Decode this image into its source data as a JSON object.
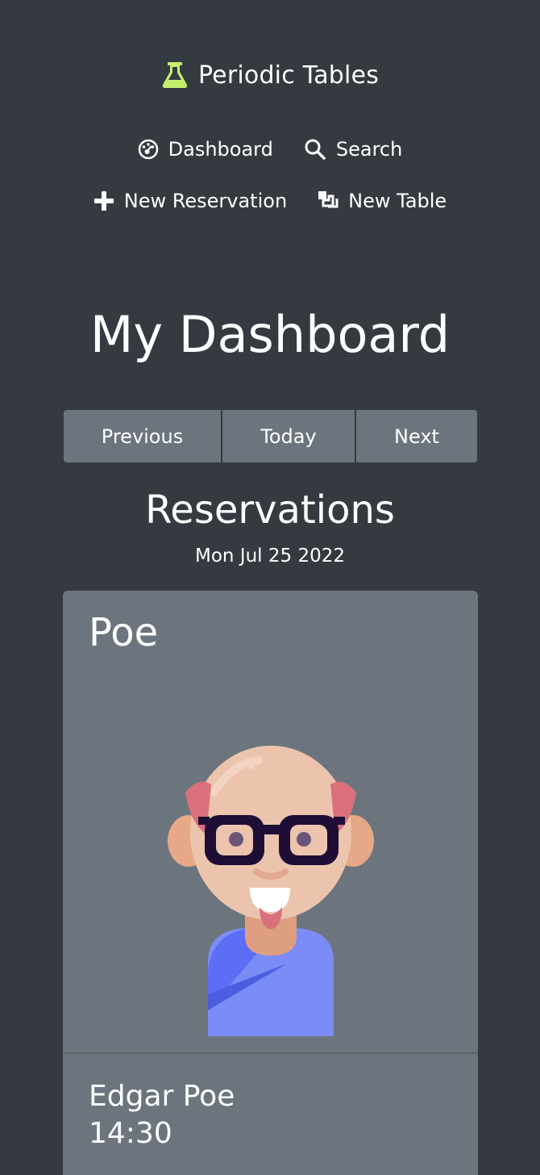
{
  "brand": {
    "name": "Periodic Tables",
    "icon": "flask-icon",
    "icon_color": "#c5f06e"
  },
  "nav": {
    "dashboard": "Dashboard",
    "search": "Search",
    "new_reservation": "New Reservation",
    "new_table": "New Table"
  },
  "main": {
    "title": "My Dashboard",
    "buttons": {
      "previous": "Previous",
      "today": "Today",
      "next": "Next"
    },
    "reservations_heading": "Reservations",
    "date": "Mon Jul 25 2022"
  },
  "reservations": [
    {
      "last_name": "Poe",
      "full_name": "Edgar Poe",
      "time": "14:30",
      "avatar": "bald-man-glasses-avatar"
    }
  ],
  "colors": {
    "background": "#343a40",
    "secondary": "#6c757d",
    "accent": "#c5f06e"
  }
}
